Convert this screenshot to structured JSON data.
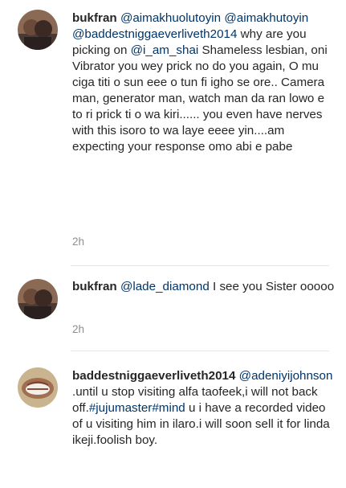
{
  "comments": [
    {
      "username": "bukfran",
      "mentions": [
        "@aimakhuolutoyin",
        "@aimakhutoyin",
        "@baddestniggaeverliveth2014",
        "@i_am_shai"
      ],
      "text_1": "why are you picking on",
      "text_2": "Shameless lesbian, oni Vibrator you wey prick no do you again, O mu ciga titi o sun eee o tun fi igho se ore.. Camera  man, generator man, watch man da ran lowo e to ri prick ti o wa kiri...... you even have nerves with this isoro to wa laye eeee yin....am expecting your response omo abi e pabe",
      "time": "2h"
    },
    {
      "username": "bukfran",
      "mention": "@lade_diamond",
      "text": "I see you Sister ooooo",
      "time": "2h"
    },
    {
      "username": "baddestniggaeverliveth2014",
      "mention": "@adeniyijohnson",
      "text_1": ".until u stop visiting alfa taofeek,i will not back off.",
      "hashtag": "#jujumaster#mind",
      "text_2": "u i have a recorded video of u visiting him in ilaro.i will soon sell it for linda ikeji.foolish boy."
    }
  ],
  "colors": {
    "text": "#262626",
    "link": "#003569",
    "meta": "#8e8e8e",
    "divider": "#e6e6e6"
  }
}
